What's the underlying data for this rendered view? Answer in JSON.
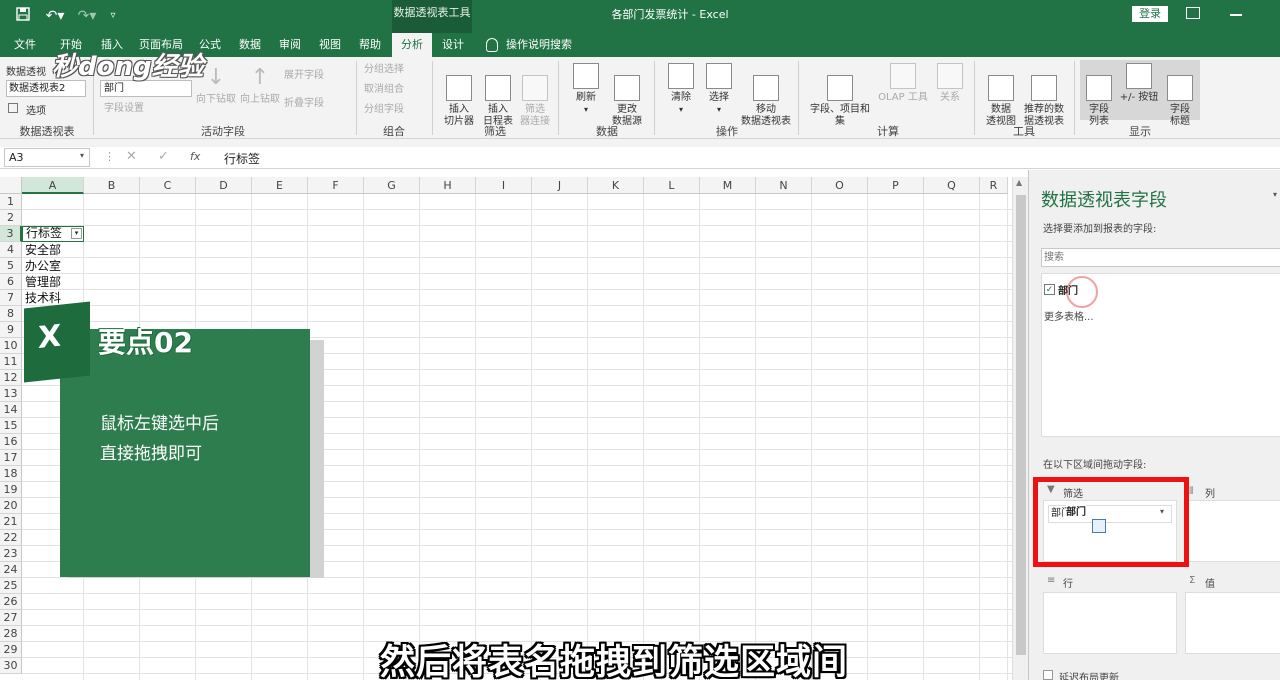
{
  "app": {
    "tool_context": "数据透视表工具",
    "title": "各部门发票统计 - Excel",
    "login": "登录",
    "brand_watermark": "秒dong经验"
  },
  "tabs": [
    "文件",
    "开始",
    "插入",
    "页面布局",
    "公式",
    "数据",
    "审阅",
    "视图",
    "帮助",
    "分析",
    "设计"
  ],
  "tellme": "操作说明搜索",
  "ribbon": {
    "pivot_name_label": "数据透视表名称:",
    "pivot_name_short": "数据透视",
    "pivot_name_value": "数据透视表2",
    "options": "选项",
    "group_pivot": "数据透视表",
    "active_field_value": "部门",
    "field_settings": "字段设置",
    "drill_down": "向下钻取",
    "drill_up": "向上钻取",
    "expand_field": "展开字段",
    "collapse_field": "折叠字段",
    "group_active": "活动字段",
    "group_selection": "分组选择",
    "ungroup": "取消组合",
    "group_field": "分组字段",
    "group_group": "组合",
    "insert_slicer": "插入\n切片器",
    "insert_timeline": "插入\n日程表",
    "filter_connections": "筛选\n器连接",
    "group_filter": "筛选",
    "refresh": "刷新",
    "change_source": "更改\n数据源",
    "group_data": "数据",
    "clear": "清除",
    "select": "选择",
    "move_pivot": "移动\n数据透视表",
    "group_actions": "操作",
    "fields_items": "字段、项目和\n集",
    "olap": "OLAP 工具",
    "relationships": "关系",
    "group_calc": "计算",
    "pivot_chart": "数据\n透视图",
    "recommended": "推荐的数\n据透视表",
    "group_tools": "工具",
    "field_list": "字段\n列表",
    "buttons": "+/- 按钮",
    "field_headers": "字段\n标题",
    "group_show": "显示"
  },
  "formula_bar": {
    "name_box": "A3",
    "fx": "fx",
    "content": "行标签"
  },
  "columns": [
    "A",
    "B",
    "C",
    "D",
    "E",
    "F",
    "G",
    "H",
    "I",
    "J",
    "K",
    "L",
    "M",
    "N",
    "O",
    "P",
    "Q",
    "R"
  ],
  "rows": [
    "1",
    "2",
    "3",
    "4",
    "5",
    "6",
    "7",
    "8",
    "9",
    "10",
    "11",
    "12",
    "13",
    "14",
    "15",
    "16",
    "17",
    "18",
    "19",
    "20",
    "21",
    "22",
    "23",
    "24",
    "25",
    "26",
    "27",
    "28",
    "29",
    "30"
  ],
  "cells": {
    "a3": "行标签",
    "a4": "安全部",
    "a5": "办公室",
    "a6": "管理部",
    "a7": "技术科"
  },
  "overlay": {
    "logo_letter": "X",
    "title": "要点02",
    "line1": "鼠标左键选中后",
    "line2": "直接拖拽即可"
  },
  "panel": {
    "title": "数据透视表字段",
    "choose": "选择要添加到报表的字段:",
    "search_placeholder": "搜索",
    "field1": "部门",
    "more_tables": "更多表格...",
    "drag_hint": "在以下区域间拖动字段:",
    "filters": "筛选",
    "columns": "列",
    "rows": "行",
    "values": "值",
    "filter_item": "部门",
    "dragging_item": "部门",
    "defer": "延迟布局更新"
  },
  "subtitle": "然后将表名拖拽到筛选区域间",
  "colors": {
    "excel_green": "#217346",
    "highlight_red": "#e11",
    "overlay_green": "#2e7d4f"
  }
}
